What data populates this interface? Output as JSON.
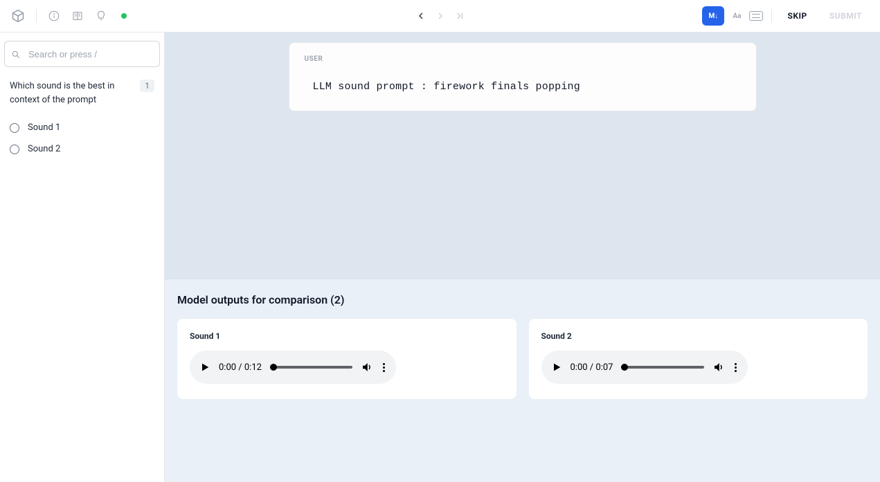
{
  "header": {
    "markdown_label": "M↓",
    "aa_label": "Aa",
    "skip_label": "SKIP",
    "submit_label": "SUBMIT"
  },
  "sidebar": {
    "search_placeholder": "Search or press /",
    "question": "Which sound is the best in context of the prompt",
    "question_badge": "1",
    "options": [
      {
        "label": "Sound 1"
      },
      {
        "label": "Sound 2"
      }
    ]
  },
  "prompt": {
    "role": "USER",
    "text": "LLM sound prompt : firework finals popping"
  },
  "outputs": {
    "title": "Model outputs for comparison (2)",
    "items": [
      {
        "label": "Sound 1",
        "time": "0:00 / 0:12"
      },
      {
        "label": "Sound 2",
        "time": "0:00 / 0:07"
      }
    ]
  }
}
